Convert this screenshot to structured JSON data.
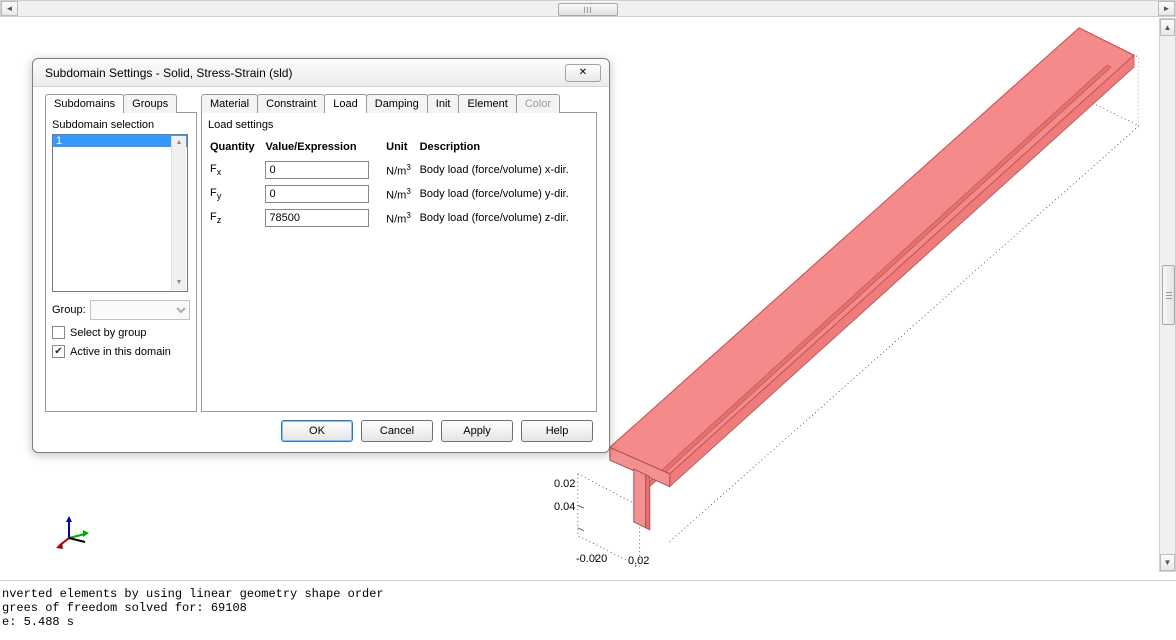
{
  "dialog": {
    "title": "Subdomain Settings - Solid, Stress-Strain (sld)",
    "left_tabs": [
      "Subdomains",
      "Groups"
    ],
    "left_active_tab": 0,
    "right_tabs": [
      "Material",
      "Constraint",
      "Load",
      "Damping",
      "Init",
      "Element",
      "Color"
    ],
    "right_active_tab": 2,
    "right_disabled_tabs": [
      6
    ],
    "subdomain_section_label": "Subdomain selection",
    "subdomain_list": [
      "1"
    ],
    "group_label": "Group:",
    "select_by_group_label": "Select by group",
    "select_by_group_checked": false,
    "active_in_domain_label": "Active in this domain",
    "active_in_domain_checked": true,
    "load_settings_title": "Load settings",
    "load_headers": {
      "qty": "Quantity",
      "val": "Value/Expression",
      "unit": "Unit",
      "desc": "Description"
    },
    "loads": [
      {
        "qsym": "F",
        "qsub": "x",
        "value": "0",
        "unit_base": "N/m",
        "unit_sup": "3",
        "desc": "Body load (force/volume) x-dir."
      },
      {
        "qsym": "F",
        "qsub": "y",
        "value": "0",
        "unit_base": "N/m",
        "unit_sup": "3",
        "desc": "Body load (force/volume) y-dir."
      },
      {
        "qsym": "F",
        "qsub": "z",
        "value": "78500",
        "unit_base": "N/m",
        "unit_sup": "3",
        "desc": "Body load (force/volume) z-dir."
      }
    ],
    "buttons": {
      "ok": "OK",
      "cancel": "Cancel",
      "apply": "Apply",
      "help": "Help"
    }
  },
  "axis_labels": {
    "y1": "0.02",
    "y2": "0.04",
    "x1": "-0.020",
    "x2": "0.02"
  },
  "beam_color": "#f48a8a",
  "console_lines": [
    "nverted elements by using linear geometry shape order",
    "grees of freedom solved for: 69108",
    "e: 5.488 s"
  ]
}
